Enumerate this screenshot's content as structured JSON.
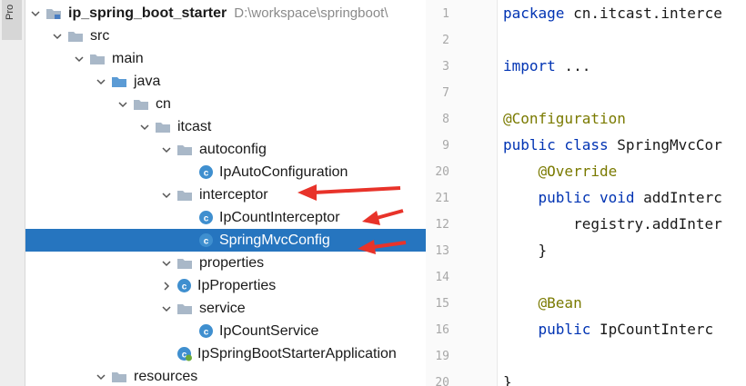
{
  "side_tab": {
    "label": "Pro"
  },
  "project_tree": {
    "root": {
      "name": "ip_spring_boot_starter",
      "path": "D:\\workspace\\springboot\\"
    },
    "items": [
      {
        "label": "src",
        "type": "folder",
        "expanded": true
      },
      {
        "label": "main",
        "type": "folder",
        "expanded": true
      },
      {
        "label": "java",
        "type": "folder",
        "expanded": true
      },
      {
        "label": "cn",
        "type": "folder",
        "expanded": true
      },
      {
        "label": "itcast",
        "type": "folder",
        "expanded": true
      },
      {
        "label": "autoconfig",
        "type": "folder",
        "expanded": true
      },
      {
        "label": "IpAutoConfiguration",
        "type": "class"
      },
      {
        "label": "interceptor",
        "type": "folder",
        "expanded": true
      },
      {
        "label": "IpCountInterceptor",
        "type": "class"
      },
      {
        "label": "SpringMvcConfig",
        "type": "class",
        "selected": true
      },
      {
        "label": "properties",
        "type": "folder",
        "expanded": true
      },
      {
        "label": "IpProperties",
        "type": "class",
        "expanded": false
      },
      {
        "label": "service",
        "type": "folder",
        "expanded": true
      },
      {
        "label": "IpCountService",
        "type": "class"
      },
      {
        "label": "IpSpringBootStarterApplication",
        "type": "main-class"
      },
      {
        "label": "resources",
        "type": "folder",
        "expanded": true
      }
    ]
  },
  "editor": {
    "line_numbers": [
      "1",
      "2",
      "3",
      "7",
      "8",
      "9",
      "20",
      "21",
      "12",
      "13",
      "14",
      "15",
      "16",
      "19",
      "20"
    ],
    "lines": [
      {
        "kw": "package",
        "rest": " cn.itcast.interce"
      },
      {
        "kw": "",
        "rest": ""
      },
      {
        "kw": "import",
        "rest": " ..."
      },
      {
        "kw": "",
        "rest": ""
      },
      {
        "ann": "@Configuration",
        "rest": ""
      },
      {
        "kw": "public class",
        "rest": " SpringMvcCor"
      },
      {
        "ann": "    @Override",
        "rest": ""
      },
      {
        "kw": "    public void",
        "rest": " addInterc"
      },
      {
        "kw": "",
        "rest": "        registry.addInter"
      },
      {
        "kw": "",
        "rest": "    }"
      },
      {
        "kw": "",
        "rest": ""
      },
      {
        "ann": "    @Bean",
        "rest": ""
      },
      {
        "kw": "    public",
        "rest": " IpCountInterc"
      },
      {
        "kw": "",
        "rest": ""
      },
      {
        "kw": "",
        "rest": "}"
      }
    ]
  },
  "colors": {
    "selection": "#2675bf",
    "arrow": "#e8332a",
    "keyword": "#0033b3",
    "annotation": "#7a7a00"
  },
  "icons": {
    "folder": "folder-icon",
    "class": "class-c-icon",
    "main_class": "spring-class-icon"
  }
}
